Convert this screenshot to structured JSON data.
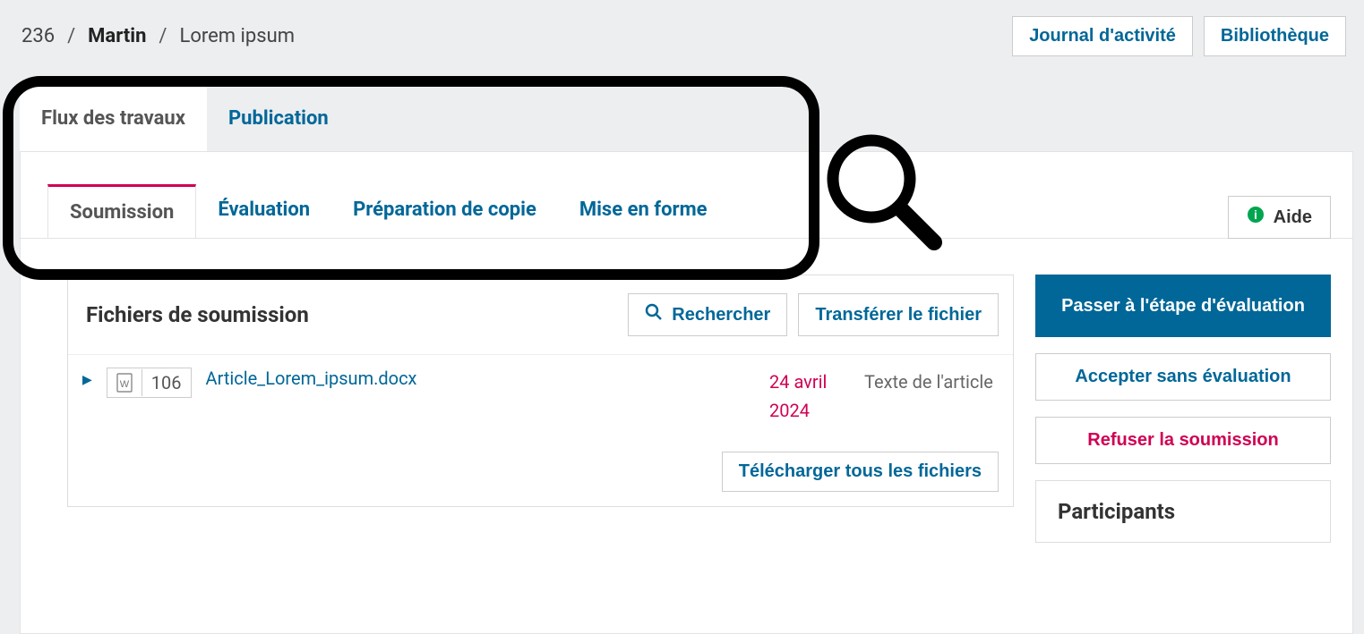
{
  "breadcrumb": {
    "id": "236",
    "author": "Martin",
    "title": "Lorem ipsum"
  },
  "top_actions": {
    "activity_log": "Journal d'activité",
    "library": "Bibliothèque"
  },
  "outer_tabs": {
    "workflow": "Flux des travaux",
    "publication": "Publication"
  },
  "inner_tabs": {
    "submission": "Soumission",
    "evaluation": "Évaluation",
    "copyediting": "Préparation de copie",
    "production": "Mise en forme"
  },
  "help_label": "Aide",
  "files": {
    "section_title": "Fichiers de soumission",
    "search_label": "Rechercher",
    "upload_label": "Transférer le fichier",
    "download_all": "Télécharger tous les fichiers",
    "items": [
      {
        "id": "106",
        "name": "Article_Lorem_ipsum.docx",
        "date": "24 avril 2024",
        "type": "Texte de l'article"
      }
    ]
  },
  "actions": {
    "send_to_review": "Passer à l'étape d'évaluation",
    "accept_skip": "Accepter sans évaluation",
    "decline": "Refuser la soumission"
  },
  "participants_title": "Participants"
}
